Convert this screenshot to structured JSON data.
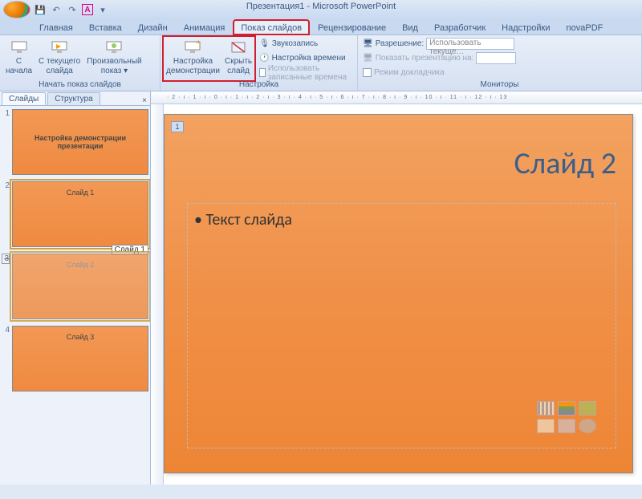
{
  "window": {
    "title": "Презентация1 - Microsoft PowerPoint"
  },
  "qat": {
    "save": "💾",
    "undo": "↶",
    "redo": "↷",
    "bold": "A",
    "more": "▾"
  },
  "tabs": {
    "home": "Главная",
    "insert": "Вставка",
    "design": "Дизайн",
    "animation": "Анимация",
    "slideshow": "Показ слайдов",
    "review": "Рецензирование",
    "view": "Вид",
    "developer": "Разработчик",
    "addins": "Надстройки",
    "novapdf": "novaPDF"
  },
  "ribbon": {
    "group1": {
      "from_begin_l1": "С",
      "from_begin_l2": "начала",
      "from_current_l1": "С текущего",
      "from_current_l2": "слайда",
      "custom_l1": "Произвольный",
      "custom_l2": "показ ▾",
      "label": "Начать показ слайдов"
    },
    "group2": {
      "setup_l1": "Настройка",
      "setup_l2": "демонстрации",
      "hide_l1": "Скрыть",
      "hide_l2": "слайд",
      "record": "Звукозапись",
      "rehearse": "Настройка времени",
      "use_timings": "Использовать записанные времена",
      "label": "Настройка"
    },
    "group3": {
      "resolution": "Разрешение:",
      "resolution_value": "Использовать текуще…",
      "show_on": "Показать презентацию на:",
      "presenter": "Режим докладчика",
      "label": "Мониторы"
    }
  },
  "left": {
    "tab_slides": "Слайды",
    "tab_outline": "Структура",
    "close": "×",
    "thumbs": [
      {
        "n": "1",
        "line1": "Настройка демонстрации",
        "line2": "презентации"
      },
      {
        "n": "2",
        "line1": "Слайд 1"
      },
      {
        "n": "3",
        "line1": "Слайд 2"
      },
      {
        "n": "4",
        "line1": "Слайд 3"
      }
    ],
    "tooltip": "Слайд 1"
  },
  "ruler": "· 2 · ı · 1 · ı · 0 · ı · 1 · ı · 2 · ı · 3 · ı · 4 · ı · 5 · ı · 6 · ı · 7 · ı · 8 · ı · 9 · ı · 10 · ı · 11 · ı · 12 · ı · 13",
  "slide": {
    "page_num": "1",
    "title": "Слайд 2",
    "body": "Текст слайда"
  }
}
